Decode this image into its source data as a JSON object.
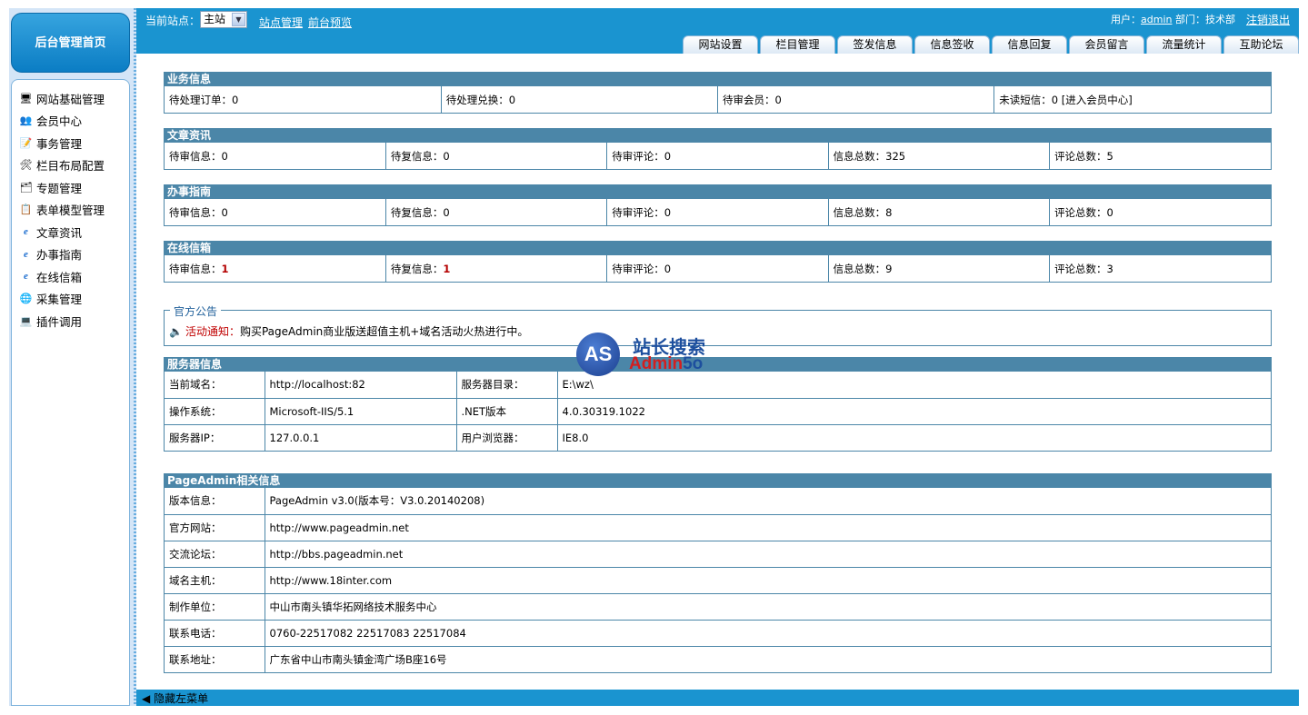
{
  "sidebar": {
    "home": "后台管理首页",
    "items": [
      {
        "label": "网站基础管理",
        "icon": "site-settings-icon"
      },
      {
        "label": "会员中心",
        "icon": "members-icon"
      },
      {
        "label": "事务管理",
        "icon": "tasks-icon"
      },
      {
        "label": "栏目布局配置",
        "icon": "tools-icon"
      },
      {
        "label": "专题管理",
        "icon": "topics-icon"
      },
      {
        "label": "表单模型管理",
        "icon": "forms-icon"
      },
      {
        "label": "文章资讯",
        "icon": "ie-icon"
      },
      {
        "label": "办事指南",
        "icon": "ie-icon"
      },
      {
        "label": "在线信箱",
        "icon": "ie-icon"
      },
      {
        "label": "采集管理",
        "icon": "collect-icon"
      },
      {
        "label": "插件调用",
        "icon": "plugin-icon"
      }
    ]
  },
  "topbar": {
    "site_label": "当前站点：",
    "site_selected": "主站",
    "site_manage": "站点管理",
    "preview": "前台预览",
    "user_prefix": "用户：",
    "user_name": "admin",
    "dept": "部门：技术部",
    "logout": "注销退出",
    "tabs": [
      "网站设置",
      "栏目管理",
      "签发信息",
      "信息签收",
      "信息回复",
      "会员留言",
      "流量统计",
      "互助论坛"
    ]
  },
  "business": {
    "title": "业务信息",
    "cells": [
      "待处理订单：0",
      "待处理兑换：0",
      "待审会员：0",
      "未读短信：0 [进入会员中心]"
    ]
  },
  "articles": {
    "title": "文章资讯",
    "cells": [
      "待审信息：0",
      "待复信息：0",
      "待审评论：0",
      "信息总数：325",
      "评论总数：5"
    ]
  },
  "guide": {
    "title": "办事指南",
    "cells": [
      "待审信息：0",
      "待复信息：0",
      "待审评论：0",
      "信息总数：8",
      "评论总数：0"
    ]
  },
  "mailbox": {
    "title": "在线信箱",
    "pending_label": "待审信息：",
    "pending_value": "1",
    "reply_label": "待复信息：",
    "reply_value": "1",
    "cells": [
      "待审评论：0",
      "信息总数：9",
      "评论总数：3"
    ]
  },
  "notice": {
    "legend": "官方公告",
    "tag": "活动通知：",
    "text": "购买PageAdmin商业版送超值主机+域名活动火热进行中。"
  },
  "server": {
    "title": "服务器信息",
    "rows": [
      [
        "当前域名：",
        "http://localhost:82",
        "服务器目录：",
        "E:\\wz\\"
      ],
      [
        "操作系统：",
        "Microsoft-IIS/5.1",
        ".NET版本",
        "4.0.30319.1022"
      ],
      [
        "服务器IP：",
        "127.0.0.1",
        "用户浏览器：",
        "IE8.0"
      ]
    ]
  },
  "pageadmin": {
    "title": "PageAdmin相关信息",
    "rows": [
      [
        "版本信息：",
        "PageAdmin v3.0(版本号：V3.0.20140208)"
      ],
      [
        "官方网站：",
        "http://www.pageadmin.net"
      ],
      [
        "交流论坛：",
        "http://bbs.pageadmin.net"
      ],
      [
        "域名主机：",
        "http://www.18inter.com"
      ],
      [
        "制作单位：",
        "中山市南头镇华拓网络技术服务中心"
      ],
      [
        "联系电话：",
        "0760-22517082 22517083 22517084"
      ],
      [
        "联系地址：",
        "广东省中山市南头镇金湾广场B座16号"
      ]
    ]
  },
  "watermark": {
    "badge": "AS",
    "cn": "站长搜索",
    "en_a": "Admin",
    "en_b": "5o"
  },
  "bottom": {
    "hide_menu": "隐藏左菜单"
  }
}
